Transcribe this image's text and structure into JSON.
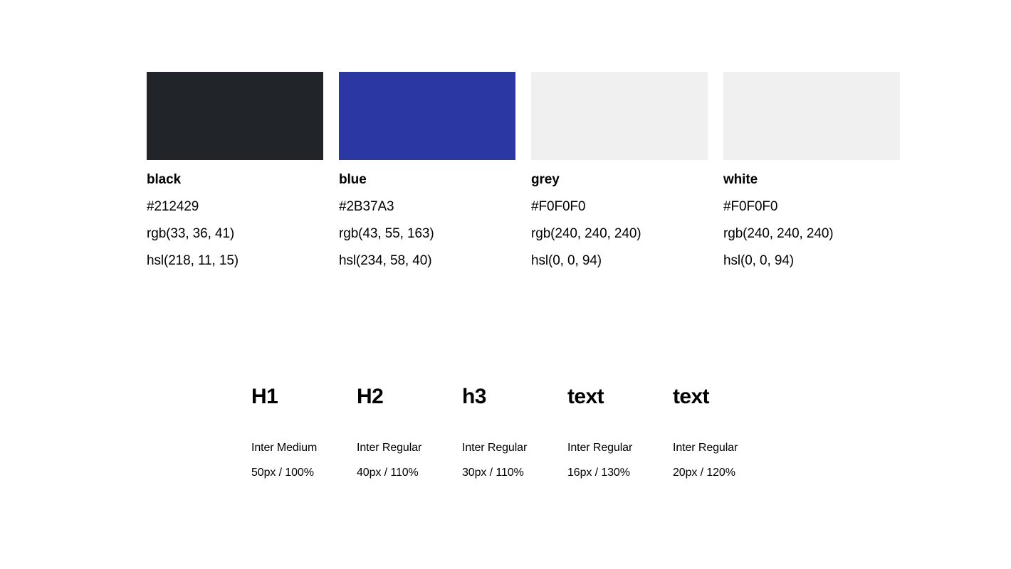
{
  "page": {
    "background_color": "#FFFFFF",
    "text_color": "#000000"
  },
  "palette": {
    "swatches": [
      {
        "name": "black",
        "hex": "#212429",
        "rgb": "rgb(33, 36, 41)",
        "hsl": "hsl(218, 11, 15)",
        "chip_color": "#212429"
      },
      {
        "name": "blue",
        "hex": "#2B37A3",
        "rgb": "rgb(43, 55, 163)",
        "hsl": "hsl(234, 58, 40)",
        "chip_color": "#2B37A3"
      },
      {
        "name": "grey",
        "hex": "#F0F0F0",
        "rgb": "rgb(240, 240, 240)",
        "hsl": "hsl(0, 0, 94)",
        "chip_color": "#F0F0F0"
      },
      {
        "name": "white",
        "hex": "#F0F0F0",
        "rgb": "rgb(240, 240, 240)",
        "hsl": "hsl(0, 0, 94)",
        "chip_color": "#F0F0F0"
      }
    ]
  },
  "typography": {
    "styles": [
      {
        "sample": "H1",
        "family": "Inter Medium",
        "size": "50px / 100%"
      },
      {
        "sample": "H2",
        "family": "Inter Regular",
        "size": "40px / 110%"
      },
      {
        "sample": "h3",
        "family": "Inter Regular",
        "size": "30px / 110%"
      },
      {
        "sample": "text",
        "family": "Inter Regular",
        "size": "16px / 130%"
      },
      {
        "sample": "text",
        "family": "Inter Regular",
        "size": "20px / 120%"
      }
    ]
  }
}
